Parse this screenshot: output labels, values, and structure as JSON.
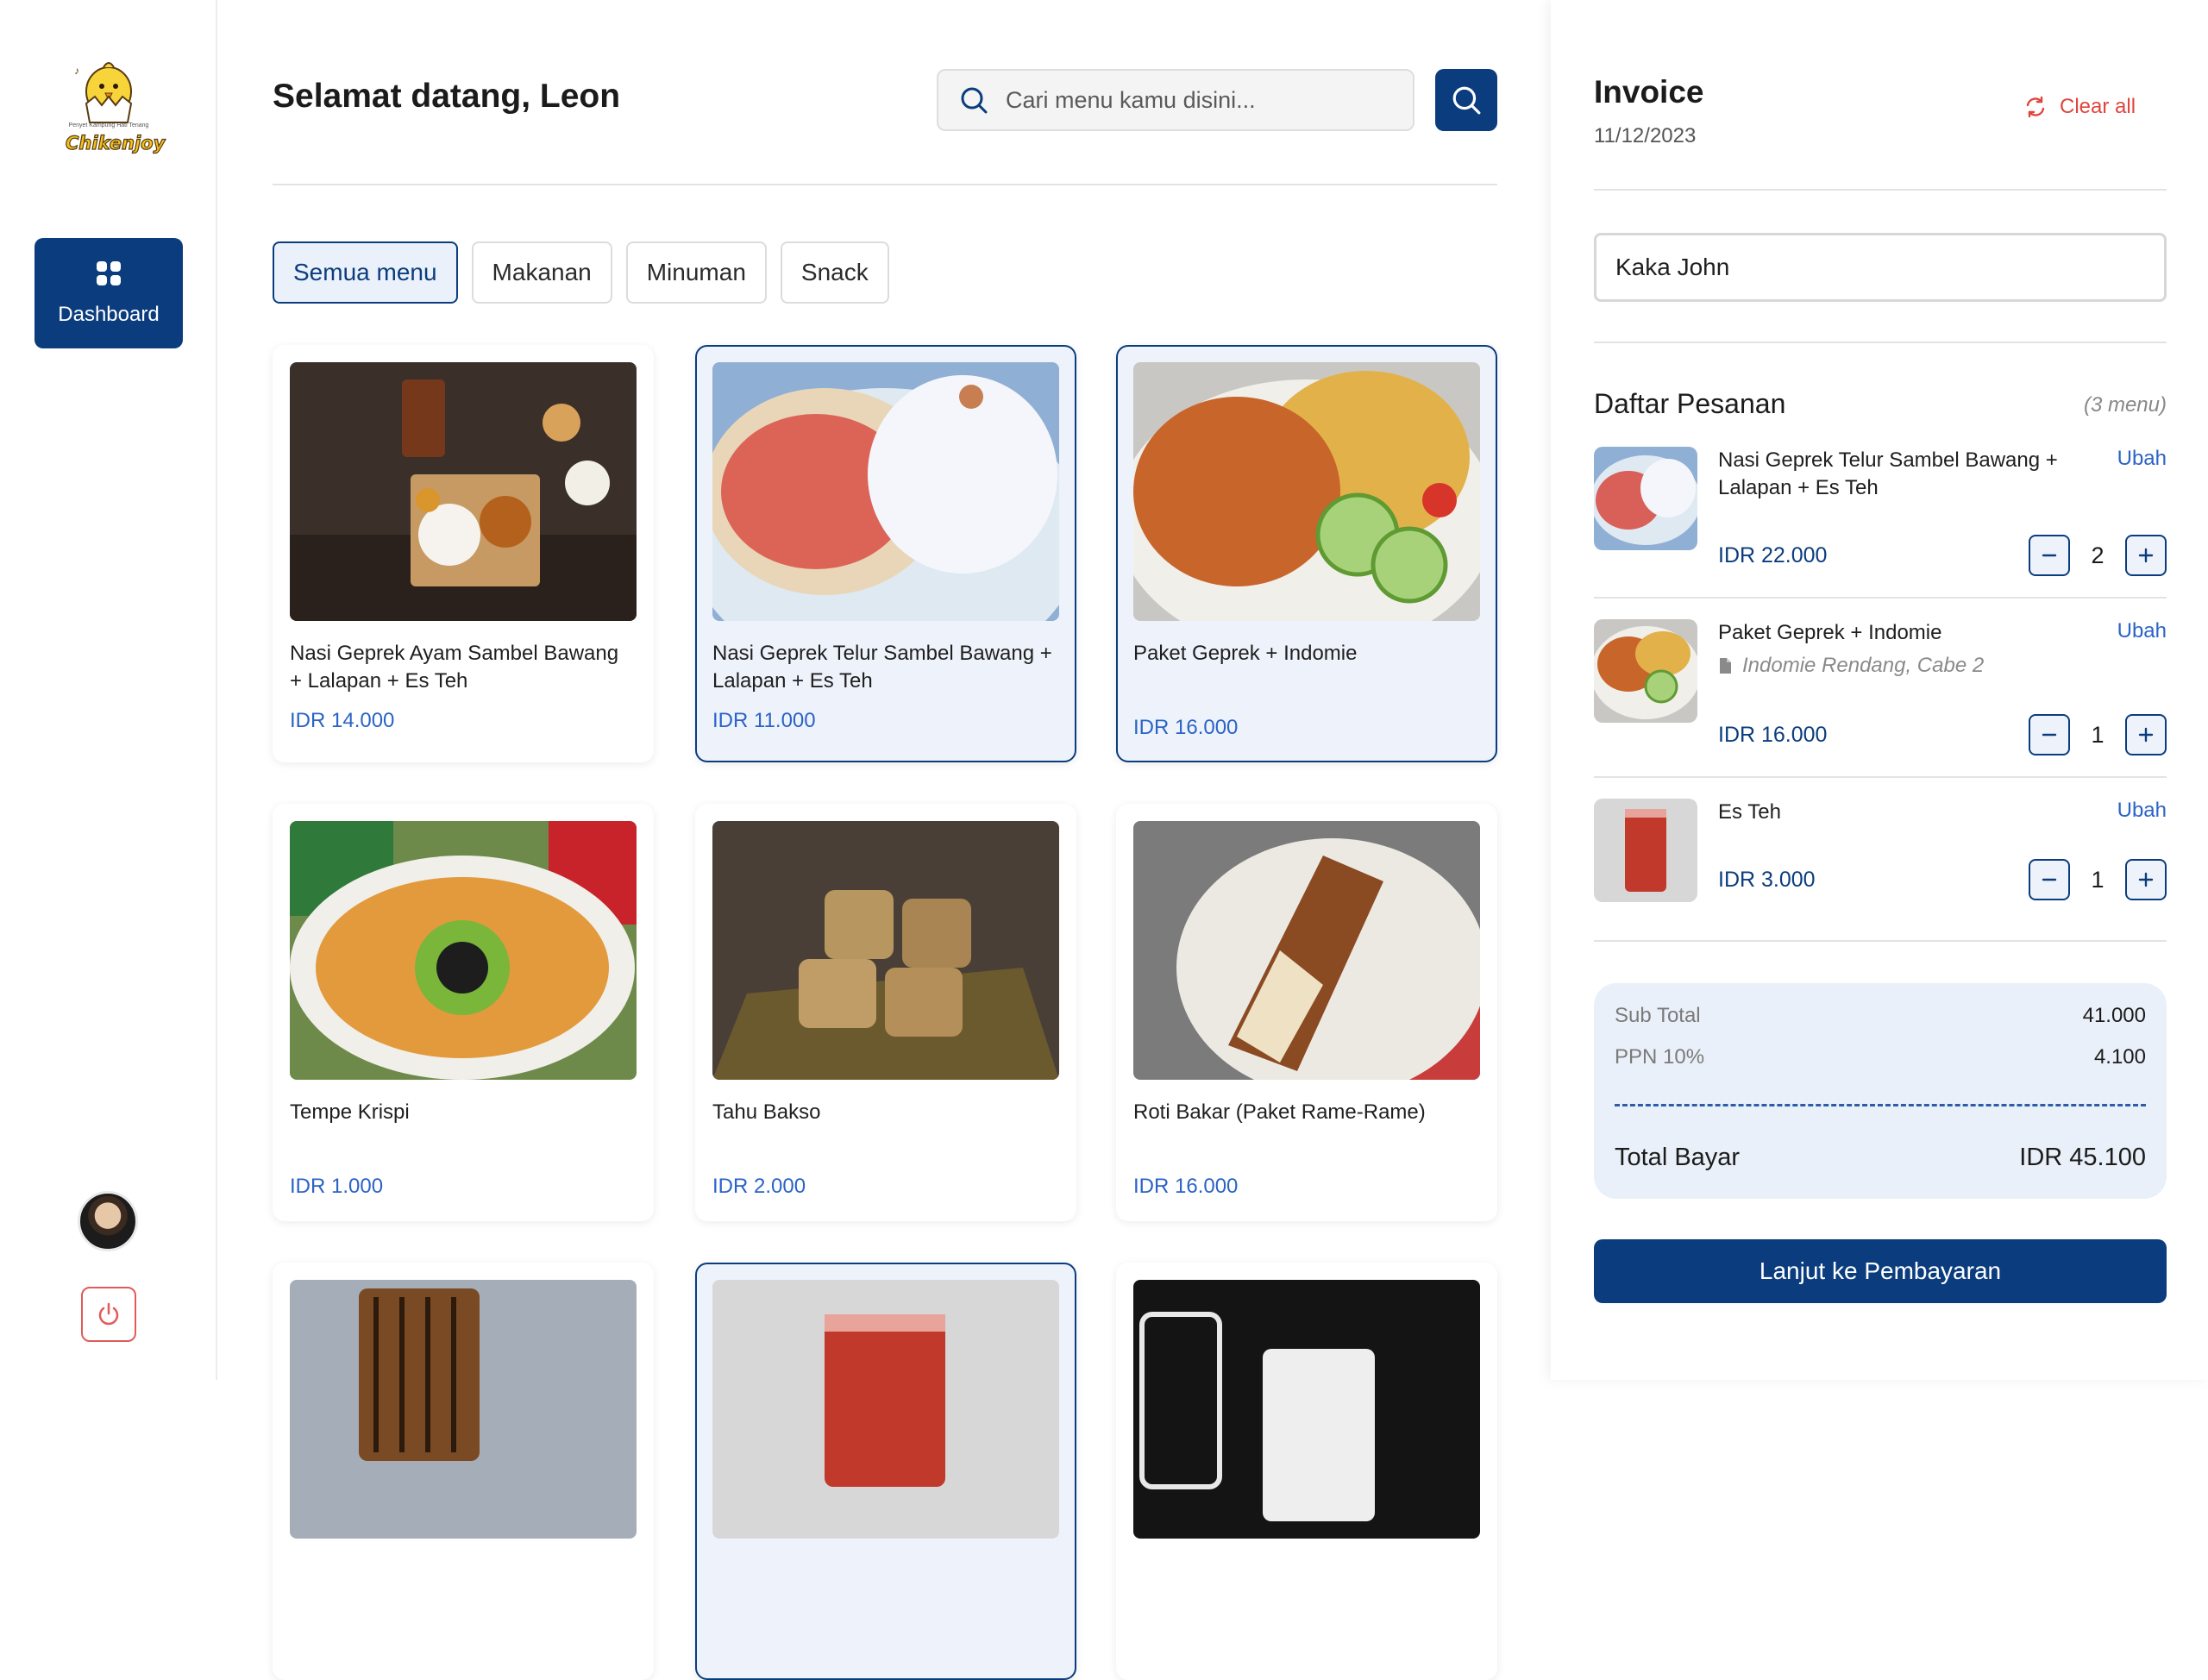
{
  "sidebar": {
    "logo_text": "Chikenjoy",
    "logo_tagline": "Penyet Kampung Hati Tenang",
    "nav_dashboard_label": "Dashboard"
  },
  "header": {
    "greeting": "Selamat datang, Leon",
    "search_placeholder": "Cari menu kamu disini..."
  },
  "tabs": [
    {
      "label": "Semua menu",
      "active": true
    },
    {
      "label": "Makanan",
      "active": false
    },
    {
      "label": "Minuman",
      "active": false
    },
    {
      "label": "Snack",
      "active": false
    }
  ],
  "menu": [
    {
      "name": "Nasi Geprek Ayam Sambel Bawang + Lalapan + Es Teh",
      "price": "IDR 14.000",
      "selected": false
    },
    {
      "name": "Nasi Geprek Telur Sambel Bawang + Lalapan + Es Teh",
      "price": "IDR 11.000",
      "selected": true
    },
    {
      "name": "Paket Geprek + Indomie",
      "price": "IDR 16.000",
      "selected": true
    },
    {
      "name": "Tempe Krispi",
      "price": "IDR 1.000",
      "selected": false
    },
    {
      "name": "Tahu Bakso",
      "price": "IDR 2.000",
      "selected": false
    },
    {
      "name": "Roti Bakar (Paket Rame-Rame)",
      "price": "IDR 16.000",
      "selected": false
    }
  ],
  "invoice": {
    "title": "Invoice",
    "date": "11/12/2023",
    "clear_all": "Clear all",
    "customer_name": "Kaka John",
    "orders_title": "Daftar Pesanan",
    "orders_count": "(3 menu)",
    "edit_label": "Ubah",
    "orders": [
      {
        "name": "Nasi Geprek Telur Sambel Bawang + Lalapan + Es Teh",
        "note": "",
        "price": "IDR 22.000",
        "qty": "2"
      },
      {
        "name": "Paket Geprek + Indomie",
        "note": "Indomie Rendang, Cabe 2",
        "price": "IDR 16.000",
        "qty": "1"
      },
      {
        "name": "Es Teh",
        "note": "",
        "price": "IDR 3.000",
        "qty": "1"
      }
    ],
    "subtotal_label": "Sub Total",
    "subtotal_value": "41.000",
    "tax_label": "PPN 10%",
    "tax_value": "4.100",
    "total_label": "Total Bayar",
    "total_value": "IDR 45.100",
    "pay_button": "Lanjut ke Pembayaran"
  },
  "colors": {
    "primary": "#0b3d7e",
    "price_blue": "#2b63c6",
    "danger": "#e0443c"
  }
}
